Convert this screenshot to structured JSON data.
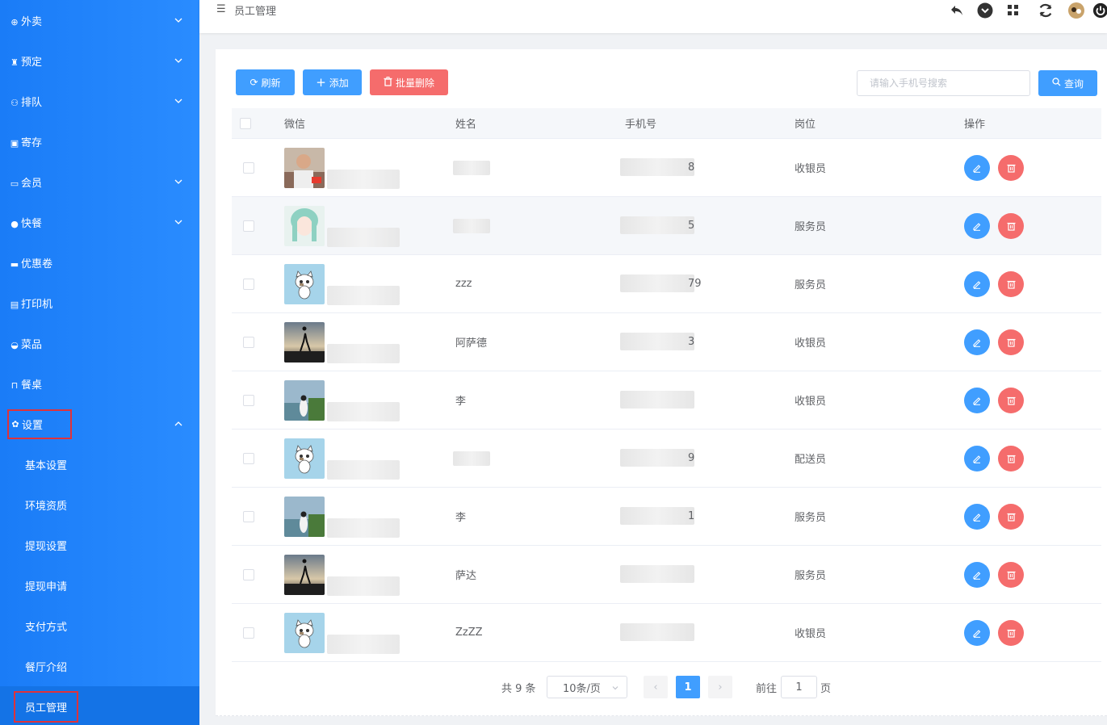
{
  "sidebar": {
    "items": [
      {
        "label": "外卖",
        "icon": "binoculars-icon",
        "glyph": "⊕",
        "arrow": "down"
      },
      {
        "label": "预定",
        "icon": "trophy-icon",
        "glyph": "♜",
        "arrow": "down"
      },
      {
        "label": "排队",
        "icon": "users-icon",
        "glyph": "⚇",
        "arrow": "down"
      },
      {
        "label": "寄存",
        "icon": "briefcase-icon",
        "glyph": "▣",
        "arrow": ""
      },
      {
        "label": "会员",
        "icon": "credit-card-icon",
        "glyph": "▭",
        "arrow": "down"
      },
      {
        "label": "快餐",
        "icon": "user-icon",
        "glyph": "●",
        "arrow": "down"
      },
      {
        "label": "优惠卷",
        "icon": "ticket-icon",
        "glyph": "▬",
        "arrow": ""
      },
      {
        "label": "打印机",
        "icon": "printer-icon",
        "glyph": "▤",
        "arrow": ""
      },
      {
        "label": "菜品",
        "icon": "bowl-icon",
        "glyph": "◒",
        "arrow": ""
      },
      {
        "label": "餐桌",
        "icon": "table-icon",
        "glyph": "⊓",
        "arrow": ""
      },
      {
        "label": "设置",
        "icon": "gear-icon",
        "glyph": "✿",
        "arrow": "up"
      }
    ],
    "sub_items": [
      "基本设置",
      "环境资质",
      "提现设置",
      "提现申请",
      "支付方式",
      "餐厅介绍",
      "员工管理"
    ]
  },
  "header": {
    "title": "员工管理"
  },
  "toolbar": {
    "refresh_label": "刷新",
    "add_label": "添加",
    "batch_delete_label": "批量删除",
    "search_placeholder": "请输入手机号搜索",
    "query_label": "查询"
  },
  "table": {
    "headers": [
      "微信",
      "姓名",
      "手机号",
      "岗位",
      "操作"
    ],
    "rows": [
      {
        "name": "",
        "phone_tail": "8",
        "role": "收银员",
        "avatar": "man-photo"
      },
      {
        "name": "",
        "phone_tail": "5",
        "role": "服务员",
        "avatar": "anime-girl"
      },
      {
        "name": "zzz",
        "phone_tail": "79",
        "role": "服务员",
        "avatar": "cartoon-cat"
      },
      {
        "name": "阿萨德",
        "phone_tail": "3",
        "role": "收银员",
        "avatar": "sunset-figure"
      },
      {
        "name": "李",
        "phone_tail": "",
        "role": "收银员",
        "avatar": "seaside-girl"
      },
      {
        "name": "",
        "phone_tail": "9",
        "role": "配送员",
        "avatar": "cartoon-cat"
      },
      {
        "name": "李",
        "phone_tail": "1",
        "role": "服务员",
        "avatar": "seaside-girl"
      },
      {
        "name": "萨达",
        "phone_tail": "",
        "role": "服务员",
        "avatar": "sunset-figure"
      },
      {
        "name": "ZzZZ",
        "phone_tail": "",
        "role": "收银员",
        "avatar": "cartoon-cat"
      }
    ]
  },
  "pagination": {
    "total_label": "共 9 条",
    "page_size_label": "10条/页",
    "current_page": "1",
    "goto_label": "前往",
    "goto_value": "1",
    "page_unit": "页"
  },
  "colors": {
    "sidebar": "#1a7cf7",
    "primary": "#409eff",
    "danger": "#f56c6c",
    "highlight_outline": "#e0323a"
  }
}
